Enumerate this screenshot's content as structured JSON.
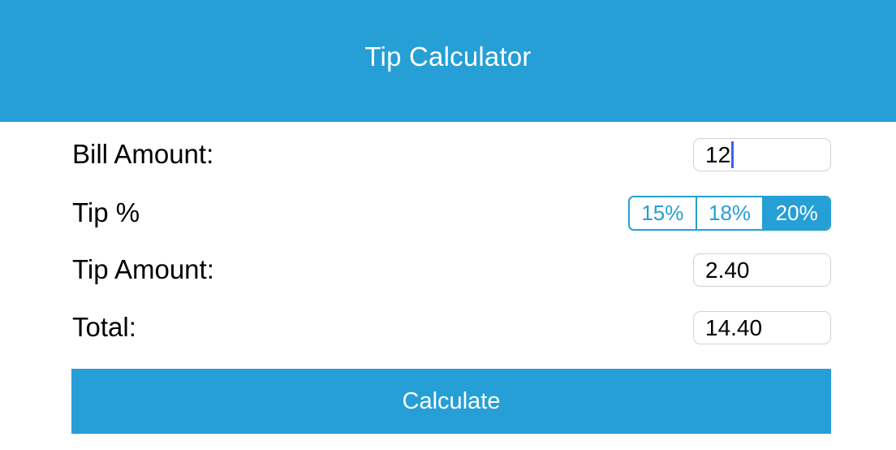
{
  "header": {
    "title": "Tip Calculator"
  },
  "form": {
    "bill_label": "Bill Amount:",
    "bill_value": "12",
    "tip_percent_label": "Tip %",
    "tip_options": [
      "15%",
      "18%",
      "20%"
    ],
    "tip_selected": "20%",
    "tip_amount_label": "Tip Amount:",
    "tip_amount_value": "2.40",
    "total_label": "Total:",
    "total_value": "14.40"
  },
  "actions": {
    "calculate_label": "Calculate"
  },
  "colors": {
    "accent": "#259fd6",
    "caret": "#3b63f0",
    "field_border": "#d2d2d2"
  }
}
